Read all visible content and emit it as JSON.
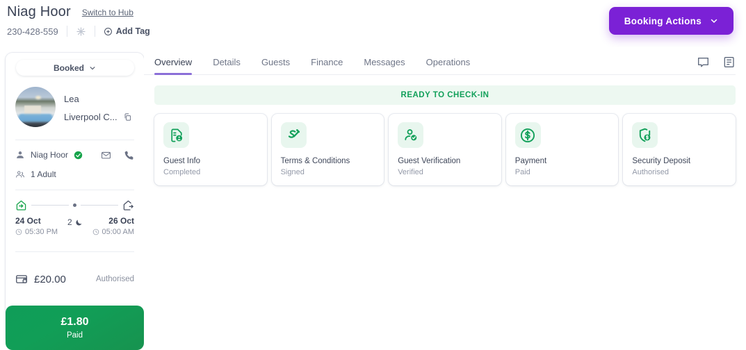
{
  "header": {
    "title": "Niag Hoor",
    "switch_link": "Switch to Hub",
    "reference": "230-428-559",
    "sparkle_icon": "sparkle-icon",
    "add_tag_label": "Add Tag",
    "booking_actions_label": "Booking Actions",
    "booking_actions_color": "#7b21d6"
  },
  "sidebar": {
    "status_label": "Booked",
    "guest_name": "Lea",
    "property_name": "Liverpool C...",
    "copy_icon": "copy-icon",
    "contact": {
      "name": "Niag Hoor",
      "verified": true,
      "mail_icon": "mail-icon",
      "phone_icon": "phone-icon"
    },
    "occupancy": "1 Adult",
    "stay": {
      "checkin_date": "24 Oct",
      "checkin_time": "05:30 PM",
      "checkout_date": "26 Oct",
      "checkout_time": "05:00 AM",
      "nights": "2"
    },
    "payment": {
      "amount": "£20.00",
      "status": "Authorised"
    },
    "paid_panel": {
      "amount": "£1.80",
      "label": "Paid"
    }
  },
  "main": {
    "tabs": [
      {
        "label": "Overview",
        "active": true
      },
      {
        "label": "Details",
        "active": false
      },
      {
        "label": "Guests",
        "active": false
      },
      {
        "label": "Finance",
        "active": false
      },
      {
        "label": "Messages",
        "active": false
      },
      {
        "label": "Operations",
        "active": false
      }
    ],
    "tab_icons": [
      "chat-icon",
      "notes-icon"
    ],
    "banner": "READY TO CHECK-IN",
    "banner_color": "#12a05a",
    "cards": [
      {
        "title": "Guest Info",
        "status": "Completed",
        "icon": "document-user-icon"
      },
      {
        "title": "Terms & Conditions",
        "status": "Signed",
        "icon": "signature-icon"
      },
      {
        "title": "Guest Verification",
        "status": "Verified",
        "icon": "user-check-icon"
      },
      {
        "title": "Payment",
        "status": "Paid",
        "icon": "dollar-circle-icon"
      },
      {
        "title": "Security Deposit",
        "status": "Authorised",
        "icon": "shield-dollar-icon"
      }
    ]
  }
}
